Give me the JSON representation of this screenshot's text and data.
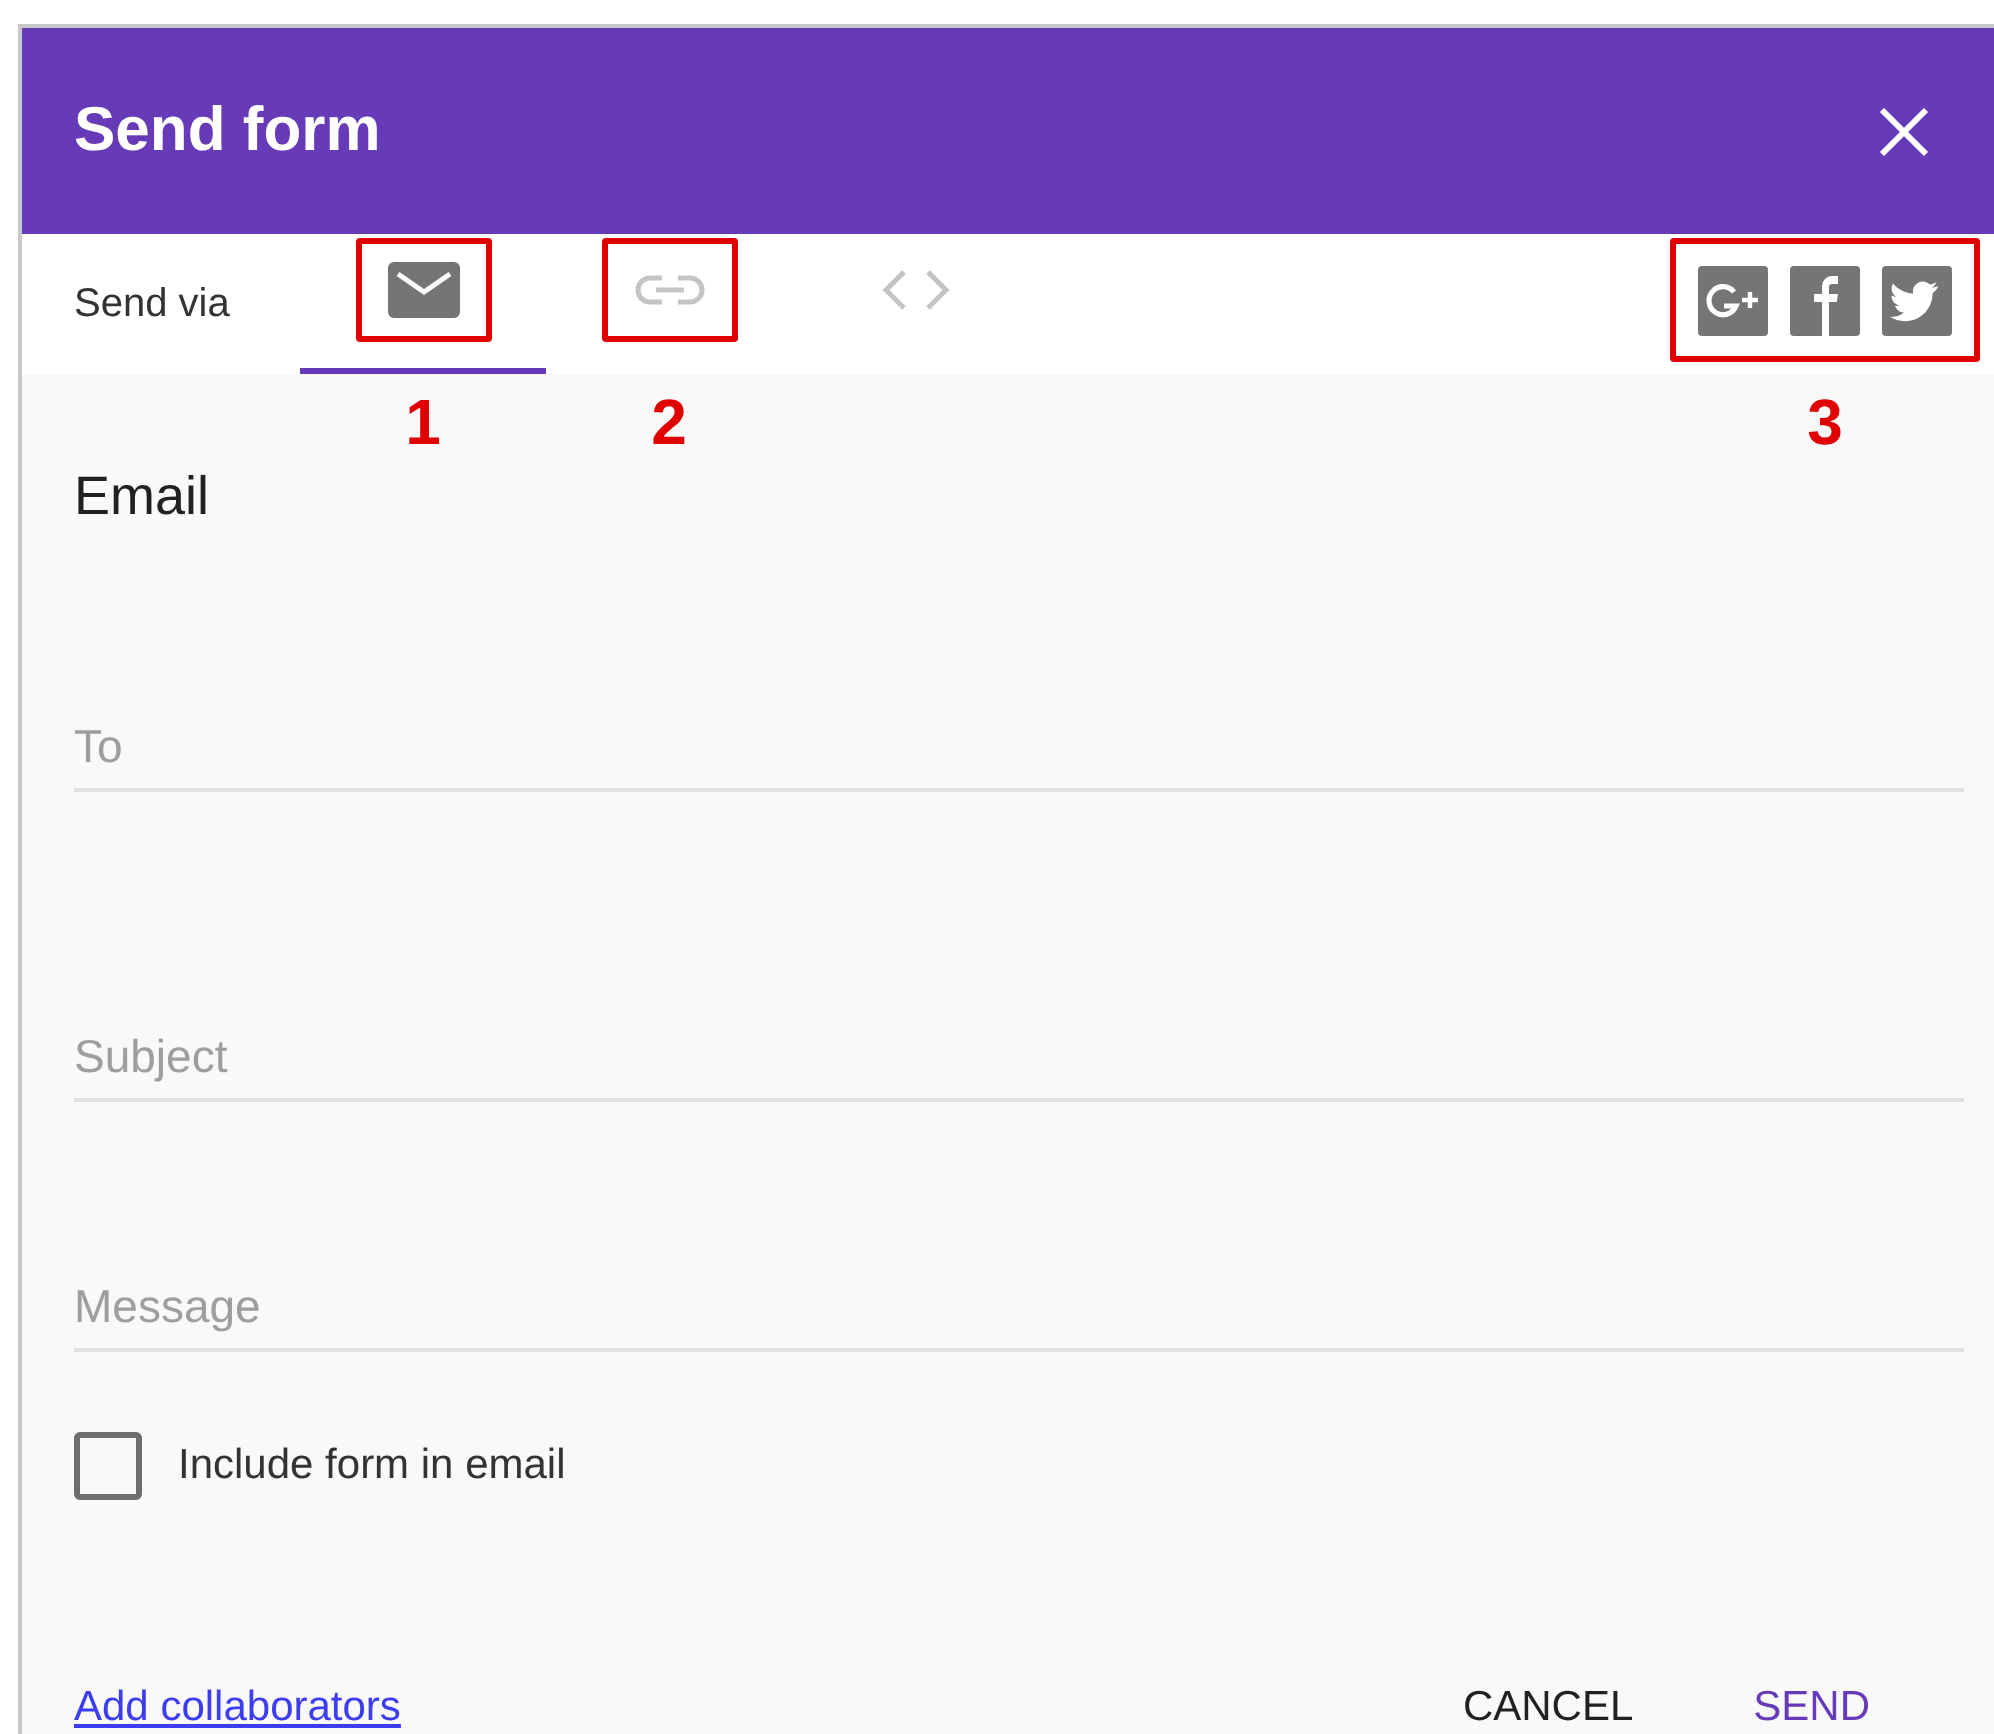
{
  "dialog": {
    "title": "Send form"
  },
  "send_via": {
    "label": "Send via",
    "tabs": [
      {
        "kind": "email",
        "selected": true,
        "callout": "1"
      },
      {
        "kind": "link",
        "selected": false,
        "callout": "2"
      },
      {
        "kind": "embed",
        "selected": false
      }
    ],
    "social": {
      "callout": "3",
      "buttons": [
        {
          "kind": "gplus"
        },
        {
          "kind": "facebook"
        },
        {
          "kind": "twitter"
        }
      ]
    }
  },
  "section_title": "Email",
  "fields": [
    {
      "placeholder": "To"
    },
    {
      "placeholder": "Subject"
    },
    {
      "placeholder": "Message"
    }
  ],
  "include_form": {
    "label": "Include form in email",
    "checked": false
  },
  "footer": {
    "link": "Add collaborators",
    "buttons": [
      {
        "label": "CANCEL",
        "kind": "secondary"
      },
      {
        "label": "SEND",
        "kind": "primary"
      }
    ]
  }
}
